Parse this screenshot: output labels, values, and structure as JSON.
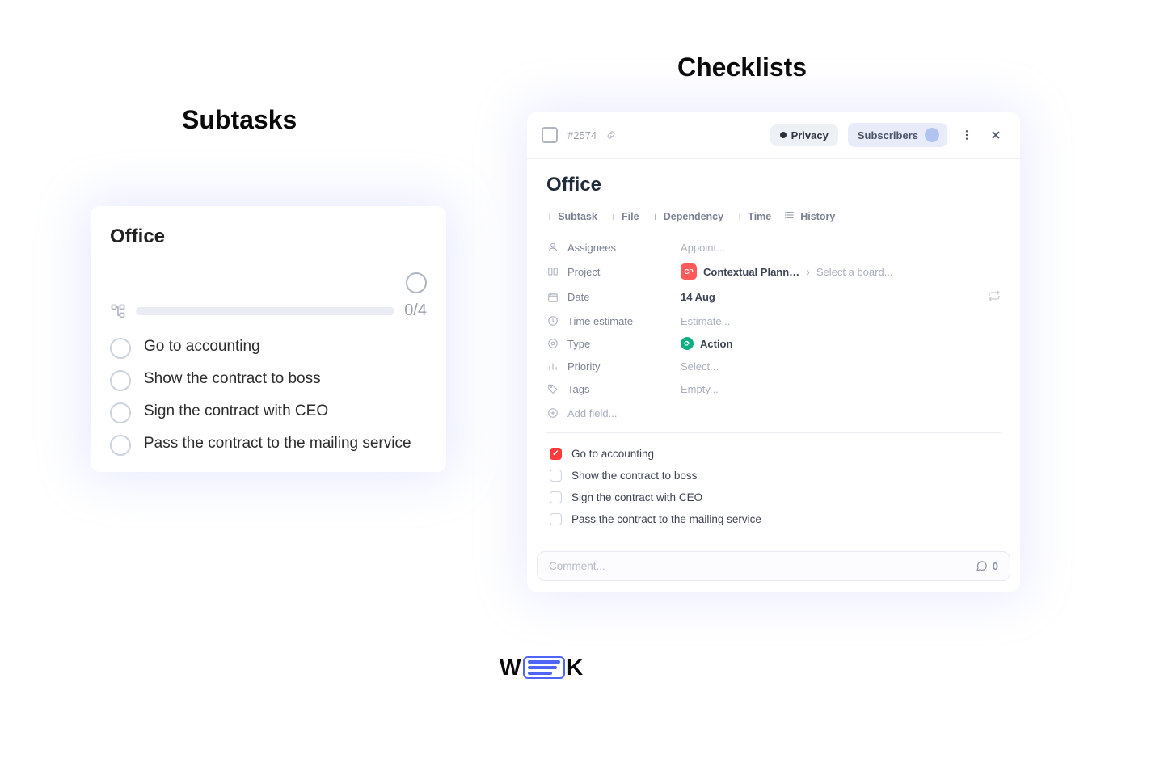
{
  "headings": {
    "subtasks": "Subtasks",
    "checklists": "Checklists"
  },
  "subtasks_card": {
    "title": "Office",
    "progress": "0/4",
    "items": [
      "Go to accounting",
      "Show the contract to boss",
      "Sign the contract with CEO",
      "Pass the contract to the mailing service"
    ]
  },
  "checklist_card": {
    "task_id": "#2574",
    "privacy_label": "Privacy",
    "subscribers_label": "Subscribers",
    "title": "Office",
    "actions": {
      "subtask": "Subtask",
      "file": "File",
      "dependency": "Dependency",
      "time": "Time",
      "history": "History"
    },
    "fields": {
      "assignees_label": "Assignees",
      "assignees_value": "Appoint...",
      "project_label": "Project",
      "project_badge": "CP",
      "project_value": "Contextual Plann…",
      "project_board_placeholder": "Select a board...",
      "date_label": "Date",
      "date_value": "14 Aug",
      "time_estimate_label": "Time estimate",
      "time_estimate_value": "Estimate...",
      "type_label": "Type",
      "type_value": "Action",
      "priority_label": "Priority",
      "priority_value": "Select...",
      "tags_label": "Tags",
      "tags_value": "Empty...",
      "add_field": "Add field..."
    },
    "checklist": [
      {
        "label": "Go to accounting",
        "checked": true
      },
      {
        "label": "Show the contract to boss",
        "checked": false
      },
      {
        "label": "Sign the contract with CEO",
        "checked": false
      },
      {
        "label": "Pass the contract to the mailing service",
        "checked": false
      }
    ],
    "comment_placeholder": "Comment...",
    "comment_count": "0"
  },
  "logo": {
    "left": "W",
    "right": "K"
  }
}
